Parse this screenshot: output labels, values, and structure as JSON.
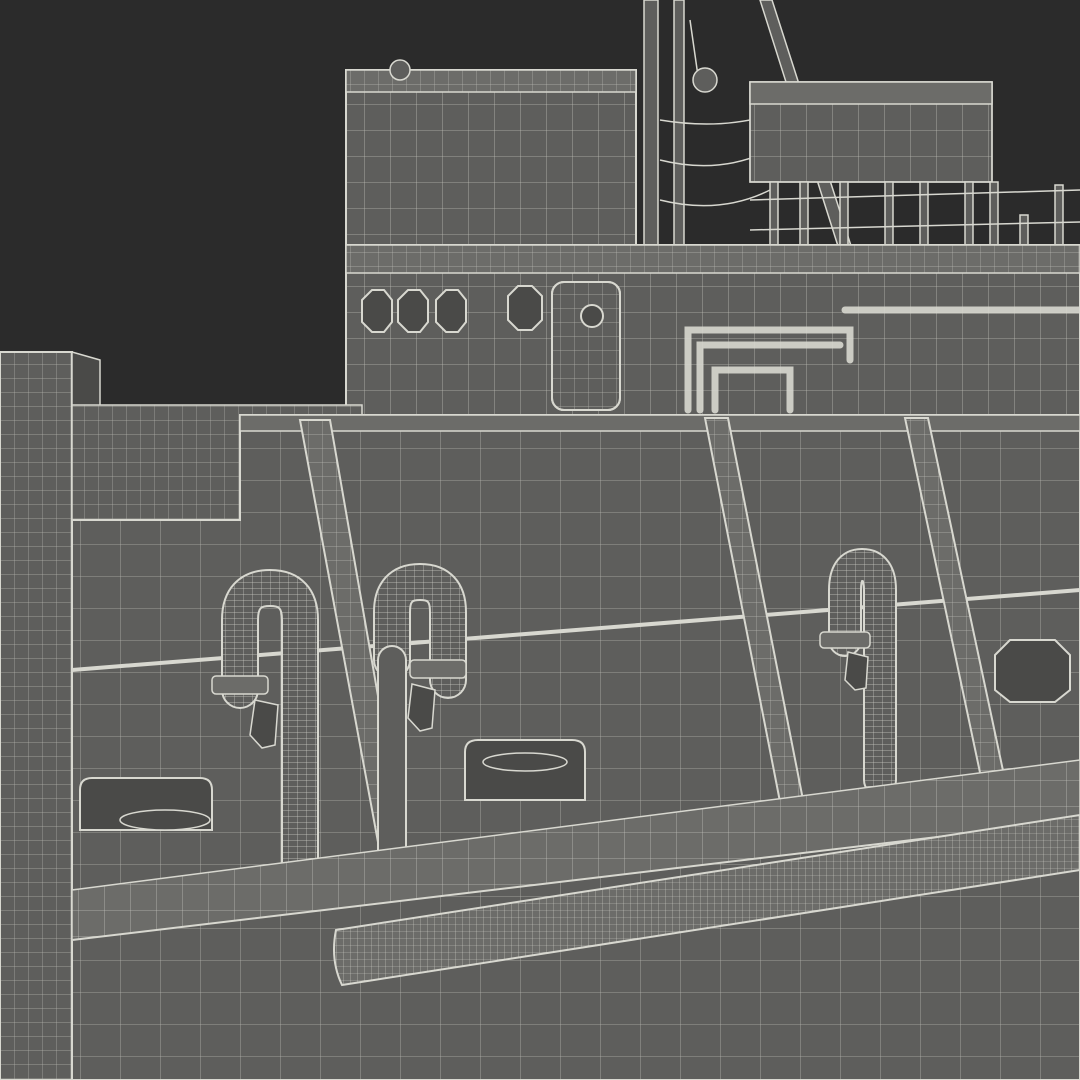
{
  "scene": {
    "subject": "ship-deck-wireframe-render",
    "palette": {
      "background": "#2b2b2b",
      "hull": "#5e5e5c",
      "hull_dark": "#4a4a48",
      "hull_light": "#6c6c69",
      "wire": "#d8d8d0",
      "wire_soft": "#b9b9b1"
    }
  }
}
